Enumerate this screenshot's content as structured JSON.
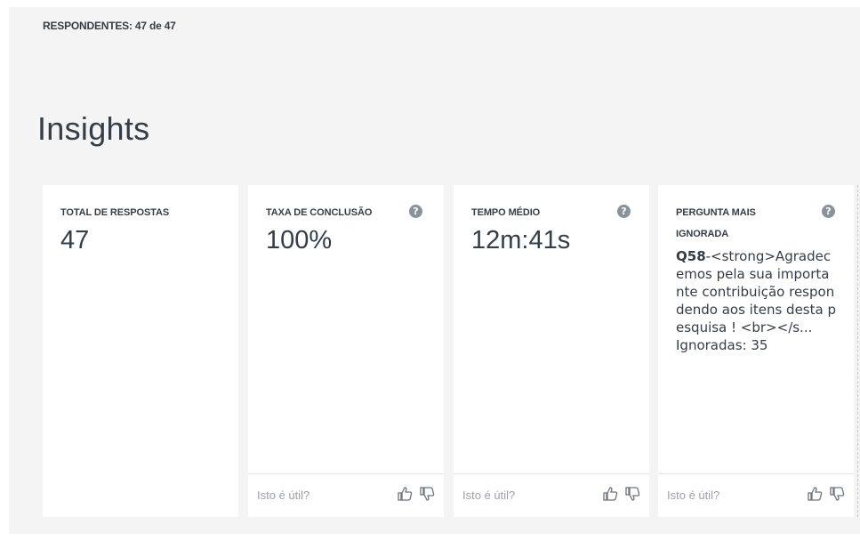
{
  "header": {
    "respondents": "RESPONDENTES: 47 de 47",
    "section_title": "Insights"
  },
  "cards": [
    {
      "label": "TOTAL DE RESPOSTAS",
      "value": "47"
    },
    {
      "label": "TAXA DE CONCLUSÃO",
      "value": "100%",
      "help_icon": "question-circle-icon",
      "feedback": "Isto é útil?"
    },
    {
      "label": "TEMPO MÉDIO",
      "value": "12m:41s",
      "help_icon": "question-circle-icon",
      "feedback": "Isto é útil?"
    },
    {
      "label": "PERGUNTA MAIS IGNORADA",
      "help_icon": "question-circle-icon",
      "question_id": "Q58",
      "question_text": "-<strong>Agradecemos pela sua importante contribuição respondendo aos itens desta pesquisa ! <br></s...",
      "skipped": "Ignoradas: 35",
      "feedback": "Isto é útil?"
    }
  ],
  "icons": {
    "help": "?",
    "thumbs_up": "thumbs-up-icon",
    "thumbs_down": "thumbs-down-icon"
  },
  "colors": {
    "panel_bg": "#f4f4f4",
    "text": "#333e48",
    "muted": "#9aa2a8",
    "help_icon_bg": "#8a939b"
  }
}
